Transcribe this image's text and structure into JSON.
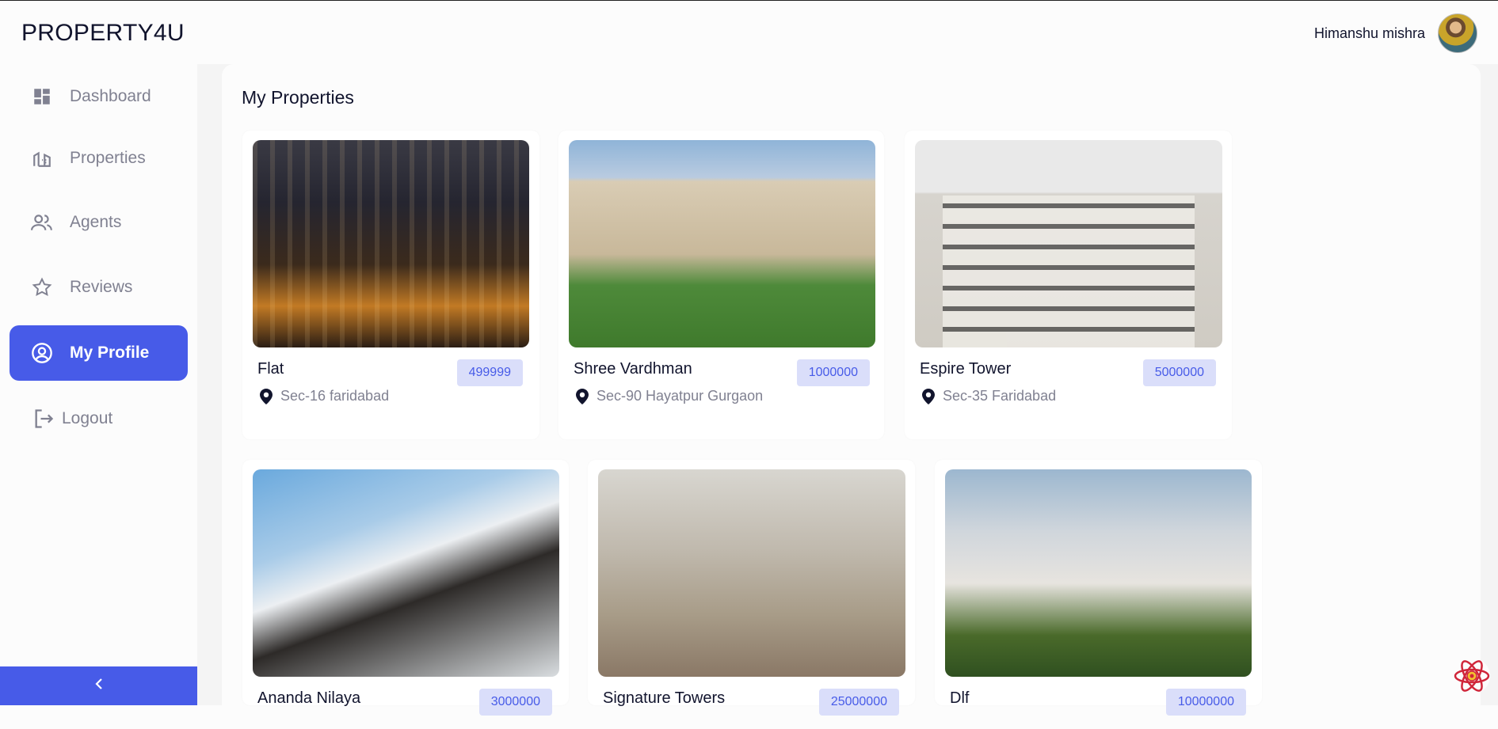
{
  "app": {
    "logo": "PROPERTY4U"
  },
  "header": {
    "user_name": "Himanshu mishra"
  },
  "sidebar": {
    "items": [
      {
        "label": "Dashboard",
        "icon": "dashboard-icon",
        "active": false
      },
      {
        "label": "Properties",
        "icon": "properties-icon",
        "active": false
      },
      {
        "label": "Agents",
        "icon": "agents-icon",
        "active": false
      },
      {
        "label": "Reviews",
        "icon": "star-icon",
        "active": false
      },
      {
        "label": "My Profile",
        "icon": "profile-icon",
        "active": true
      },
      {
        "label": "Logout",
        "icon": "logout-icon",
        "active": false
      }
    ],
    "collapse_icon": "chevron-left-icon"
  },
  "main": {
    "title": "My Properties",
    "properties": [
      {
        "name": "Flat",
        "price": "499999",
        "location": "Sec-16 faridabad"
      },
      {
        "name": "Shree Vardhman",
        "price": "1000000",
        "location": "Sec-90 Hayatpur Gurgaon"
      },
      {
        "name": "Espire Tower",
        "price": "5000000",
        "location": "Sec-35 Faridabad"
      },
      {
        "name": "Ananda Nilaya",
        "price": "3000000",
        "location": ""
      },
      {
        "name": "Signature Towers",
        "price": "25000000",
        "location": ""
      },
      {
        "name": "Dlf",
        "price": "10000000",
        "location": ""
      }
    ]
  },
  "colors": {
    "accent": "#475be8",
    "price_bg": "#dadefa",
    "muted": "#808191",
    "text": "#11142d"
  }
}
